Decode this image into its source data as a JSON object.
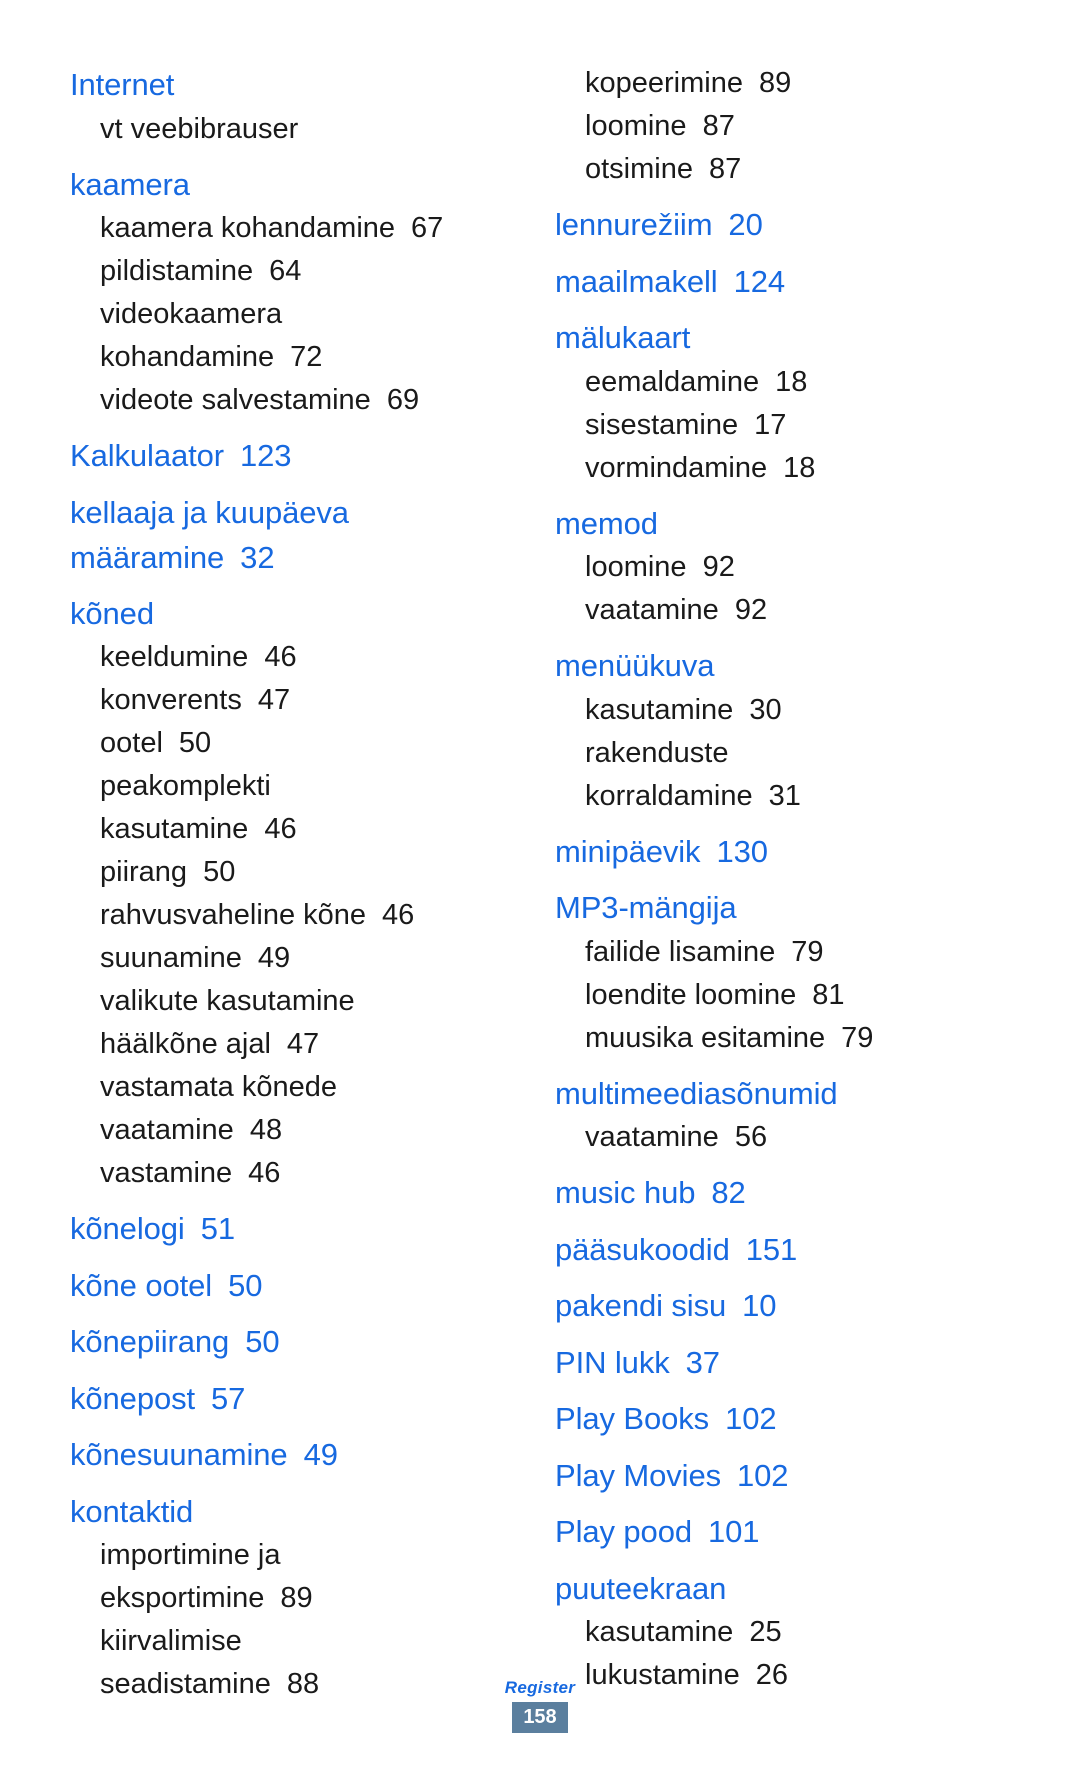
{
  "document": {
    "footer_label": "Register",
    "page_number": "158",
    "accent_color": "#1769e0",
    "body_color": "#1a1a1a",
    "badge_color": "#5b7f9e"
  },
  "columns": [
    {
      "entries": [
        {
          "term": "Internet",
          "page": "",
          "subs": [
            {
              "text": "vt veebibrauser",
              "page": ""
            }
          ]
        },
        {
          "term": "kaamera",
          "page": "",
          "subs": [
            {
              "text": "kaamera kohandamine",
              "page": "67"
            },
            {
              "text": "pildistamine",
              "page": "64"
            },
            {
              "text": "videokaamera",
              "page": ""
            },
            {
              "text": "kohandamine",
              "page": "72"
            },
            {
              "text": "videote salvestamine",
              "page": "69"
            }
          ]
        },
        {
          "term": "Kalkulaator",
          "page": "123",
          "subs": []
        },
        {
          "term": "kellaaja ja kuupäeva",
          "term2": "määramine",
          "page": "32",
          "subs": []
        },
        {
          "term": "kõned",
          "page": "",
          "subs": [
            {
              "text": "keeldumine",
              "page": "46"
            },
            {
              "text": "konverents",
              "page": "47"
            },
            {
              "text": "ootel",
              "page": "50"
            },
            {
              "text": "peakomplekti",
              "page": ""
            },
            {
              "text": "kasutamine",
              "page": "46"
            },
            {
              "text": "piirang",
              "page": "50"
            },
            {
              "text": "rahvusvaheline kõne",
              "page": "46"
            },
            {
              "text": "suunamine",
              "page": "49"
            },
            {
              "text": "valikute kasutamine",
              "page": ""
            },
            {
              "text": "häälkõne ajal",
              "page": "47"
            },
            {
              "text": "vastamata kõnede",
              "page": ""
            },
            {
              "text": "vaatamine",
              "page": "48"
            },
            {
              "text": "vastamine",
              "page": "46"
            }
          ]
        },
        {
          "term": "kõnelogi",
          "page": "51",
          "subs": []
        },
        {
          "term": "kõne ootel",
          "page": "50",
          "subs": []
        },
        {
          "term": "kõnepiirang",
          "page": "50",
          "subs": []
        },
        {
          "term": "kõnepost",
          "page": "57",
          "subs": []
        },
        {
          "term": "kõnesuunamine",
          "page": "49",
          "subs": []
        },
        {
          "term": "kontaktid",
          "page": "",
          "subs": [
            {
              "text": "importimine ja",
              "page": ""
            },
            {
              "text": "eksportimine",
              "page": "89"
            },
            {
              "text": "kiirvalimise",
              "page": ""
            },
            {
              "text": "seadistamine",
              "page": "88"
            }
          ]
        }
      ]
    },
    {
      "entries": [
        {
          "term": "",
          "page": "",
          "subs": [
            {
              "text": "kopeerimine",
              "page": "89"
            },
            {
              "text": "loomine",
              "page": "87"
            },
            {
              "text": "otsimine",
              "page": "87"
            }
          ]
        },
        {
          "term": "lennurežiim",
          "page": "20",
          "subs": []
        },
        {
          "term": "maailmakell",
          "page": "124",
          "subs": []
        },
        {
          "term": "mälukaart",
          "page": "",
          "subs": [
            {
              "text": "eemaldamine",
              "page": "18"
            },
            {
              "text": "sisestamine",
              "page": "17"
            },
            {
              "text": "vormindamine",
              "page": "18"
            }
          ]
        },
        {
          "term": "memod",
          "page": "",
          "subs": [
            {
              "text": "loomine",
              "page": "92"
            },
            {
              "text": "vaatamine",
              "page": "92"
            }
          ]
        },
        {
          "term": "menüükuva",
          "page": "",
          "subs": [
            {
              "text": "kasutamine",
              "page": "30"
            },
            {
              "text": "rakenduste",
              "page": ""
            },
            {
              "text": "korraldamine",
              "page": "31"
            }
          ]
        },
        {
          "term": "minipäevik",
          "page": "130",
          "subs": []
        },
        {
          "term": "MP3-mängija",
          "page": "",
          "subs": [
            {
              "text": "failide lisamine",
              "page": "79"
            },
            {
              "text": "loendite loomine",
              "page": "81"
            },
            {
              "text": "muusika esitamine",
              "page": "79"
            }
          ]
        },
        {
          "term": "multimeediasõnumid",
          "page": "",
          "subs": [
            {
              "text": "vaatamine",
              "page": "56"
            }
          ]
        },
        {
          "term": "music hub",
          "page": "82",
          "subs": []
        },
        {
          "term": "pääsukoodid",
          "page": "151",
          "subs": []
        },
        {
          "term": "pakendi sisu",
          "page": "10",
          "subs": []
        },
        {
          "term": "PIN lukk",
          "page": "37",
          "subs": []
        },
        {
          "term": "Play Books",
          "page": "102",
          "subs": []
        },
        {
          "term": "Play Movies",
          "page": "102",
          "subs": []
        },
        {
          "term": "Play pood",
          "page": "101",
          "subs": []
        },
        {
          "term": "puuteekraan",
          "page": "",
          "subs": [
            {
              "text": "kasutamine",
              "page": "25"
            },
            {
              "text": "lukustamine",
              "page": "26"
            }
          ]
        }
      ]
    }
  ]
}
